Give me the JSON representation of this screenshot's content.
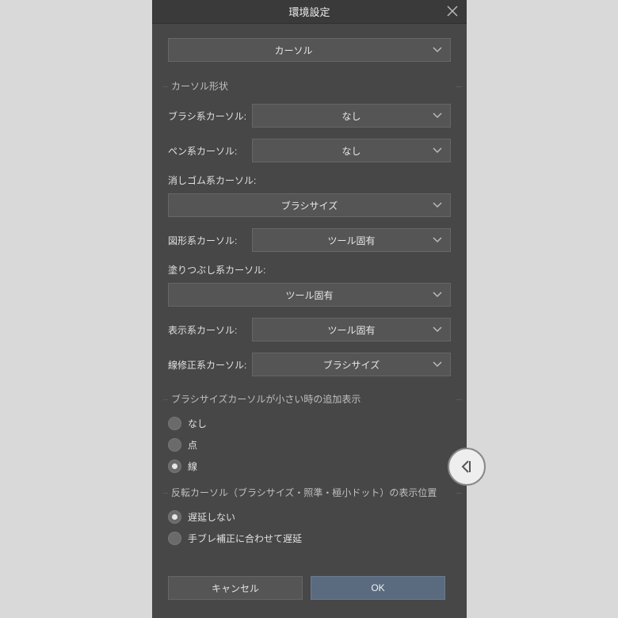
{
  "dialog": {
    "title": "環境設定"
  },
  "topCategory": {
    "value": "カーソル"
  },
  "group1": {
    "legend": "カーソル形状",
    "rows": {
      "brush": {
        "label": "ブラシ系カーソル:",
        "value": "なし"
      },
      "pen": {
        "label": "ペン系カーソル:",
        "value": "なし"
      },
      "eraser": {
        "label": "消しゴム系カーソル:",
        "value": "ブラシサイズ"
      },
      "shape": {
        "label": "図形系カーソル:",
        "value": "ツール固有"
      },
      "fill": {
        "label": "塗りつぶし系カーソル:",
        "value": "ツール固有"
      },
      "view": {
        "label": "表示系カーソル:",
        "value": "ツール固有"
      },
      "linefix": {
        "label": "線修正系カーソル:",
        "value": "ブラシサイズ"
      }
    }
  },
  "group2": {
    "legend": "ブラシサイズカーソルが小さい時の追加表示",
    "options": {
      "none": "なし",
      "dot": "点",
      "line": "線"
    },
    "selected": "line"
  },
  "group3": {
    "legend": "反転カーソル（ブラシサイズ・照準・極小ドット）の表示位置",
    "options": {
      "nodelay": "遅延しない",
      "delay": "手ブレ補正に合わせて遅延"
    },
    "selected": "nodelay"
  },
  "footer": {
    "cancel": "キャンセル",
    "ok": "OK"
  }
}
